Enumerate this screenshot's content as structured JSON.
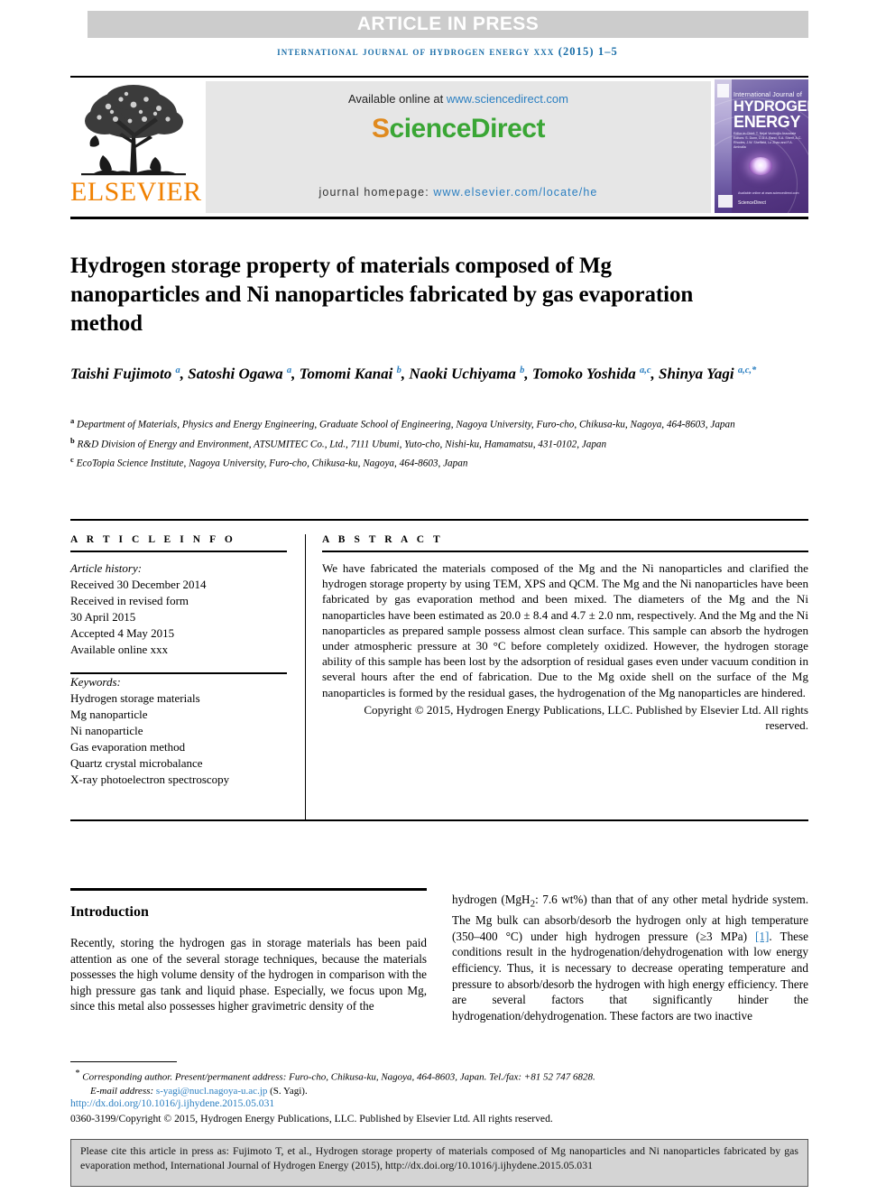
{
  "banner": {
    "article_in_press": "ARTICLE IN PRESS",
    "running_head": "international journal of hydrogen energy xxx (2015) 1–5"
  },
  "masthead": {
    "elsevier_wordmark": "ELSEVIER",
    "available_online_prefix": "Available online at ",
    "sciencedirect_url": "www.sciencedirect.com",
    "sciencedirect_logo_first": "S",
    "sciencedirect_logo_rest": "cienceDirect",
    "journal_homepage_label": "journal homepage: ",
    "journal_homepage_url": "www.elsevier.com/locate/he",
    "cover": {
      "line_small": "International Journal of",
      "line_big_1": "HYDROGEN",
      "line_big_2": "ENERGY",
      "editors": "Editor-in-Chief: T. Nejat Veziroğlu   Associate Editors: S. Dunn, D.A.J. Rand, S.A. Sherif, A.C. Rhodes, J.W. Sheffield, Lu Zhao and F.A. Aminalla",
      "science_direct_mark": "ScienceDirect",
      "available_online_mark": "Available online at www.sciencedirect.com"
    }
  },
  "article": {
    "title": "Hydrogen storage property of materials composed of Mg nanoparticles and Ni nanoparticles fabricated by gas evaporation method",
    "authors": [
      {
        "name": "Taishi Fujimoto",
        "marks": "a",
        "sep": ", "
      },
      {
        "name": "Satoshi Ogawa",
        "marks": "a",
        "sep": ", "
      },
      {
        "name": "Tomomi Kanai",
        "marks": "b",
        "sep": ", "
      },
      {
        "name": "Naoki Uchiyama",
        "marks": "b",
        "sep": ", "
      },
      {
        "name": "Tomoko Yoshida",
        "marks": "a,c",
        "sep": ", "
      },
      {
        "name": "Shinya Yagi",
        "marks": "a,c,*",
        "sep": ""
      }
    ],
    "affiliations": [
      {
        "mark": "a",
        "text": "Department of Materials, Physics and Energy Engineering, Graduate School of Engineering, Nagoya University, Furo-cho, Chikusa-ku, Nagoya, 464-8603, Japan"
      },
      {
        "mark": "b",
        "text": "R&D Division of Energy and Environment, ATSUMITEC Co., Ltd., 7111 Ubumi, Yuto-cho, Nishi-ku, Hamamatsu, 431-0102, Japan"
      },
      {
        "mark": "c",
        "text": "EcoTopia Science Institute, Nagoya University, Furo-cho, Chikusa-ku, Nagoya, 464-8603, Japan"
      }
    ]
  },
  "article_info": {
    "heading": "A R T I C L E   I N F O",
    "history_label": "Article history:",
    "history": [
      "Received 30 December 2014",
      "Received in revised form",
      "30 April 2015",
      "Accepted 4 May 2015",
      "Available online xxx"
    ],
    "keywords_label": "Keywords:",
    "keywords": [
      "Hydrogen storage materials",
      "Mg nanoparticle",
      "Ni nanoparticle",
      "Gas evaporation method",
      "Quartz crystal microbalance",
      "X-ray photoelectron spectroscopy"
    ]
  },
  "abstract": {
    "heading": "A B S T R A C T",
    "body": "We have fabricated the materials composed of the Mg and the Ni nanoparticles and clarified the hydrogen storage property by using TEM, XPS and QCM. The Mg and the Ni nanoparticles have been fabricated by gas evaporation method and been mixed. The diameters of the Mg and the Ni nanoparticles have been estimated as 20.0 ± 8.4 and 4.7 ± 2.0 nm, respectively. And the Mg and the Ni nanoparticles as prepared sample possess almost clean surface. This sample can absorb the hydrogen under atmospheric pressure at 30 °C before completely oxidized. However, the hydrogen storage ability of this sample has been lost by the adsorption of residual gases even under vacuum condition in several hours after the end of fabrication. Due to the Mg oxide shell on the surface of the Mg nanoparticles is formed by the residual gases, the hydrogenation of the Mg nanoparticles are hindered.",
    "copyright": "Copyright © 2015, Hydrogen Energy Publications, LLC. Published by Elsevier Ltd. All rights reserved."
  },
  "introduction": {
    "heading": "Introduction",
    "col_left": "Recently, storing the hydrogen gas in storage materials has been paid attention as one of the several storage techniques, because the materials possesses the high volume density of the hydrogen in comparison with the high pressure gas tank and liquid phase. Especially, we focus upon Mg, since this metal also possesses higher gravimetric density of the",
    "col_right_pre": "hydrogen (MgH",
    "col_right_sub": "2",
    "col_right_mid": ": 7.6 wt%) than that of any other metal hydride system. The Mg bulk can absorb/desorb the hydrogen only at high temperature (350–400 °C) under high hydrogen pressure (≥3 MPa) ",
    "col_right_ref": "[1]",
    "col_right_post": ". These conditions result in the hydrogenation/dehydrogenation with low energy efficiency. Thus, it is necessary to decrease operating temperature and pressure to absorb/desorb the hydrogen with high energy efficiency. There are several factors that significantly hinder the hydrogenation/dehydrogenation. These factors are two inactive"
  },
  "footer": {
    "corresponding_star": "*",
    "corresponding_text": "Corresponding author. Present/permanent address: Furo-cho, Chikusa-ku, Nagoya, 464-8603, Japan. Tel./fax: +81 52 747 6828.",
    "email_label": "E-mail address: ",
    "email_address": "s-yagi@nucl.nagoya-u.ac.jp",
    "email_owner": " (S. Yagi).",
    "doi_url": "http://dx.doi.org/10.1016/j.ijhydene.2015.05.031",
    "issn_copyright": "0360-3199/Copyright © 2015, Hydrogen Energy Publications, LLC. Published by Elsevier Ltd. All rights reserved."
  },
  "cite_box": {
    "text": "Please cite this article in press as: Fujimoto T, et al., Hydrogen storage property of materials composed of Mg nanoparticles and Ni nanoparticles fabricated by gas evaporation method, International Journal of Hydrogen Energy (2015), http://dx.doi.org/10.1016/j.ijhydene.2015.05.031"
  },
  "colors": {
    "link": "#2b7fc1",
    "banner_bg": "#cccccc",
    "elsevier_orange": "#f08000",
    "sciencedirect_green": "#3aa635",
    "panel_bg": "#e6e6e6",
    "cite_bg": "#d4d4d4"
  }
}
